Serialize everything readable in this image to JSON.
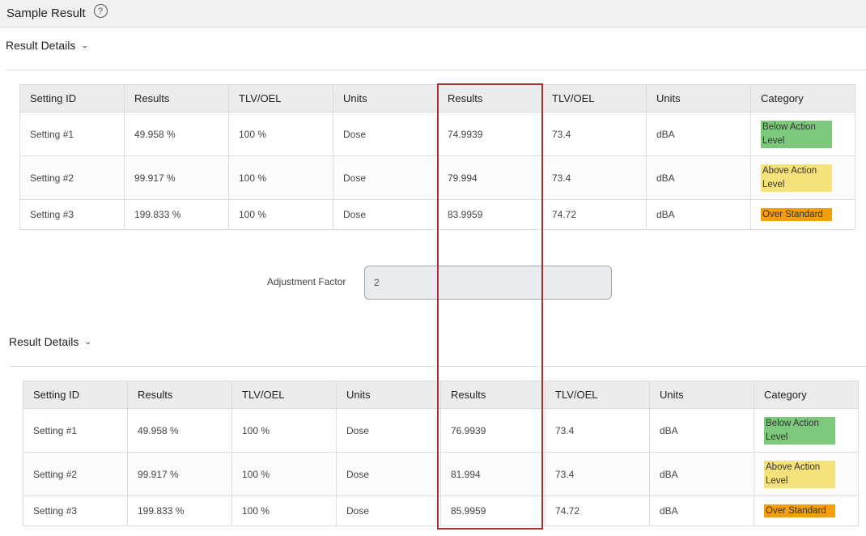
{
  "header": {
    "title": "Sample Result",
    "help_icon": "?"
  },
  "sections": [
    {
      "title": "Result Details",
      "columns": [
        "Setting ID",
        "Results",
        "TLV/OEL",
        "Units",
        "Results",
        "TLV/OEL",
        "Units",
        "Category"
      ],
      "rows": [
        {
          "setting": "Setting #1",
          "results1": "49.958 %",
          "tlv1": "100 %",
          "units1": "Dose",
          "results2": "74.9939",
          "tlv2": "73.4",
          "units2": "dBA",
          "category": "Below Action Level"
        },
        {
          "setting": "Setting #2",
          "results1": "99.917 %",
          "tlv1": "100 %",
          "units1": "Dose",
          "results2": "79.994",
          "tlv2": "73.4",
          "units2": "dBA",
          "category": "Above Action Level"
        },
        {
          "setting": "Setting #3",
          "results1": "199.833 %",
          "tlv1": "100 %",
          "units1": "Dose",
          "results2": "83.9959",
          "tlv2": "74.72",
          "units2": "dBA",
          "category": "Over Standard"
        }
      ]
    },
    {
      "title": "Result Details",
      "columns": [
        "Setting ID",
        "Results",
        "TLV/OEL",
        "Units",
        "Results",
        "TLV/OEL",
        "Units",
        "Category"
      ],
      "rows": [
        {
          "setting": "Setting #1",
          "results1": "49.958 %",
          "tlv1": "100 %",
          "units1": "Dose",
          "results2": "76.9939",
          "tlv2": "73.4",
          "units2": "dBA",
          "category": "Below Action Level"
        },
        {
          "setting": "Setting #2",
          "results1": "99.917 %",
          "tlv1": "100 %",
          "units1": "Dose",
          "results2": "81.994",
          "tlv2": "73.4",
          "units2": "dBA",
          "category": "Above Action Level"
        },
        {
          "setting": "Setting #3",
          "results1": "199.833 %",
          "tlv1": "100 %",
          "units1": "Dose",
          "results2": "85.9959",
          "tlv2": "74.72",
          "units2": "dBA",
          "category": "Over Standard"
        }
      ]
    }
  ],
  "adjustment": {
    "label": "Adjustment Factor",
    "value": "2"
  },
  "colors": {
    "below_action": "#7cc97c",
    "above_action": "#f6e27a",
    "over_standard": "#f59e0b",
    "highlight": "#a83232"
  }
}
